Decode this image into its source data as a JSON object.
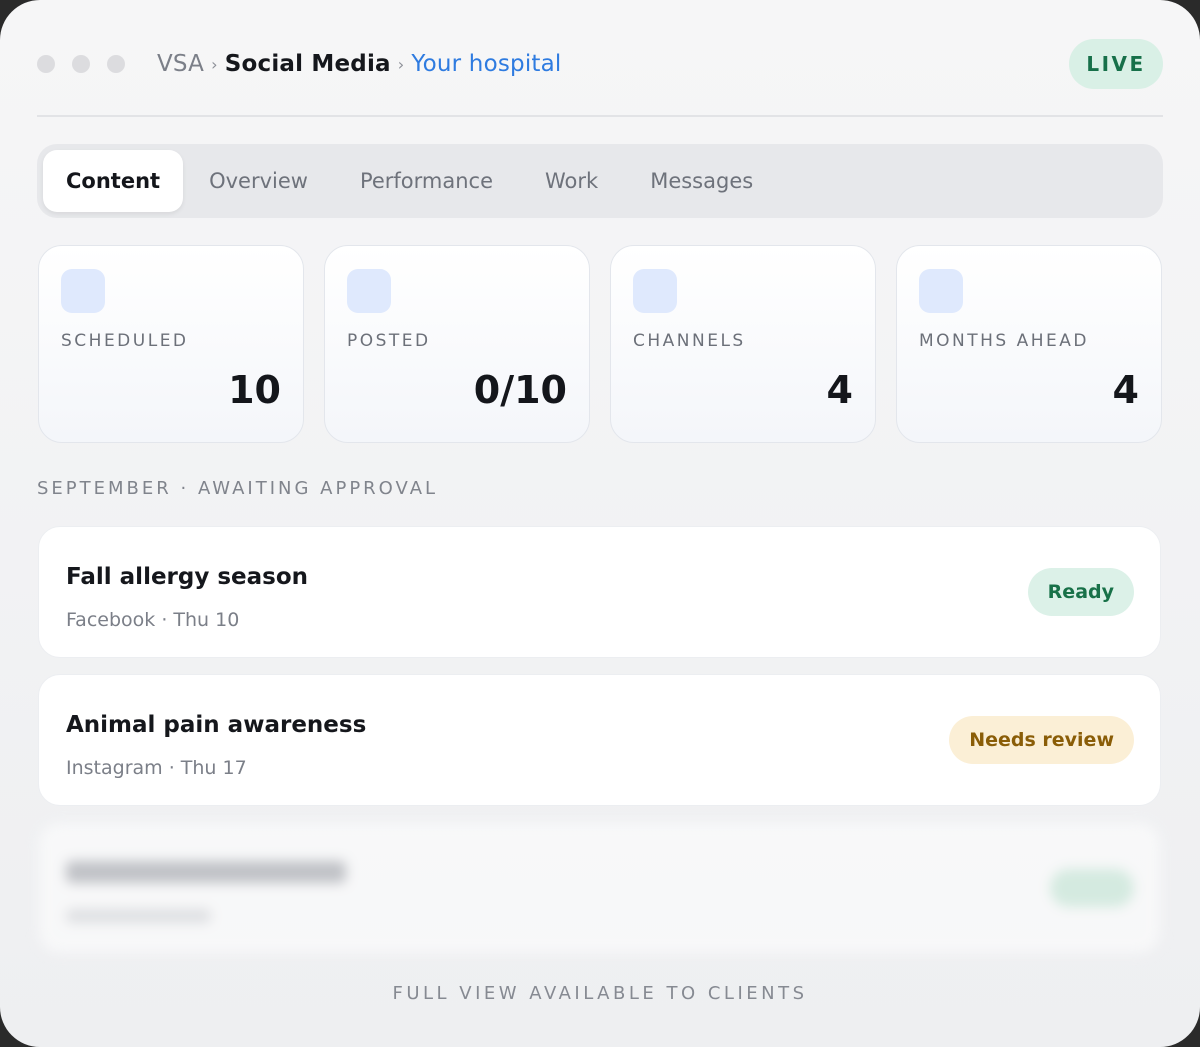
{
  "breadcrumb": {
    "root": "VSA",
    "separator": "›",
    "current": "Social Media",
    "link": "Your hospital"
  },
  "live_badge": "LIVE",
  "tabs": [
    {
      "label": "Content",
      "active": true
    },
    {
      "label": "Overview",
      "active": false
    },
    {
      "label": "Performance",
      "active": false
    },
    {
      "label": "Work",
      "active": false
    },
    {
      "label": "Messages",
      "active": false
    }
  ],
  "stats": [
    {
      "label": "SCHEDULED",
      "value": "10"
    },
    {
      "label": "POSTED",
      "value": "0/10"
    },
    {
      "label": "CHANNELS",
      "value": "4"
    },
    {
      "label": "MONTHS AHEAD",
      "value": "4"
    }
  ],
  "section_label": "SEPTEMBER · AWAITING APPROVAL",
  "posts": [
    {
      "title": "Fall allergy season",
      "meta": "Facebook · Thu 10",
      "status": "Ready"
    },
    {
      "title": "Animal pain awareness",
      "meta": "Instagram · Thu 17",
      "status": "Needs review"
    }
  ],
  "footer_note": "FULL VIEW AVAILABLE TO CLIENTS",
  "colors": {
    "accent_link": "#2e7be0",
    "live_bg": "#d9f0e6",
    "live_text": "#17704a",
    "ready_bg": "#dcf1e8",
    "ready_text": "#187148",
    "review_bg": "#fbefd6",
    "review_text": "#8a5d07"
  }
}
